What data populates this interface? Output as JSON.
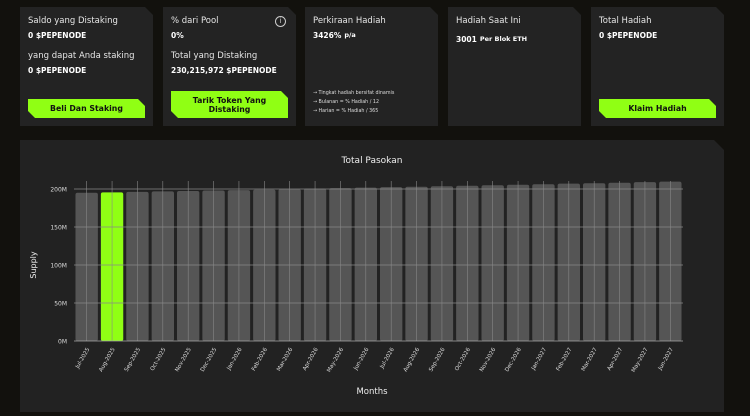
{
  "cards": {
    "staked": {
      "label": "Saldo yang Distaking",
      "value": "0 $PEPENODE",
      "label2": "yang dapat Anda staking",
      "value2": "0 $PEPENODE",
      "button": "Beli Dan Staking"
    },
    "pool": {
      "label": "% dari Pool",
      "value": "0%",
      "info_icon": "info-icon",
      "label2": "Total yang Distaking",
      "value2": "230,215,972 $PEPENODE",
      "button": "Tarik Token Yang Distaking"
    },
    "estimate": {
      "label": "Perkiraan Hadiah",
      "value": "3426%",
      "unit": "p/a",
      "notes": [
        "→ Tingkat hadiah bersifat dinamis",
        "→ Bulanan = % Hadiah / 12",
        "→ Harian = % Hadiah / 365"
      ]
    },
    "current": {
      "label": "Hadiah Saat Ini",
      "value": "3001",
      "unit": "Per Blok ETH"
    },
    "total": {
      "label": "Total Hadiah",
      "value": "0 $PEPENODE",
      "button": "Klaim Hadiah"
    }
  },
  "colors": {
    "accent": "#90ff14",
    "bar": "#555555",
    "panel": "#232323",
    "background": "#12110d"
  },
  "chart_data": {
    "type": "bar",
    "title": "Total Pasokan",
    "xlabel": "Months",
    "ylabel": "Supply",
    "ylim": [
      0,
      200000000
    ],
    "yticks": [
      "0M",
      "50M",
      "100M",
      "150M",
      "200M"
    ],
    "grid": true,
    "highlight_index": 1,
    "categories": [
      "Jul-2025",
      "Aug-2025",
      "Sep-2025",
      "Oct-2025",
      "Nov-2025",
      "Dec-2025",
      "Jan-2026",
      "Feb-2026",
      "Mar-2026",
      "Apr-2026",
      "May-2026",
      "Jun-2026",
      "Jul-2026",
      "Aug-2026",
      "Sep-2026",
      "Oct-2026",
      "Nov-2026",
      "Dec-2026",
      "Jan-2027",
      "Feb-2027",
      "Mar-2027",
      "Apr-2027",
      "May-2027",
      "Jun-2027"
    ],
    "values": [
      195000000,
      195600000,
      196200000,
      196800000,
      197400000,
      198000000,
      198600000,
      199200000,
      199800000,
      200500000,
      201100000,
      201800000,
      202400000,
      203000000,
      203700000,
      204300000,
      205000000,
      205600000,
      206300000,
      207000000,
      207600000,
      208300000,
      209000000,
      209700000
    ]
  }
}
